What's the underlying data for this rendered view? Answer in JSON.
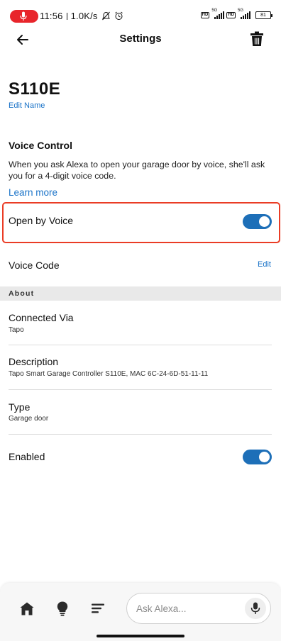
{
  "status_bar": {
    "time": "11:56",
    "network_speed": "1.0K/s",
    "hd_badge_1": "HD",
    "hd_badge_2": "HD",
    "signal_1_label": "5G",
    "signal_2_label": "5G",
    "battery": "81",
    "recording_color": "#e8252b"
  },
  "header": {
    "title": "Settings",
    "back_icon": "arrow-left-icon",
    "delete_icon": "trash-icon"
  },
  "device": {
    "name": "S110E",
    "edit_name_link": "Edit Name"
  },
  "voice_control": {
    "heading": "Voice Control",
    "description": "When you ask Alexa to open your garage door by voice, she'll ask you for a 4-digit voice code.",
    "learn_more": "Learn more",
    "open_by_voice_label": "Open by Voice",
    "open_by_voice_enabled": true,
    "voice_code_label": "Voice Code",
    "voice_code_edit": "Edit"
  },
  "about": {
    "section_label": "About",
    "items": [
      {
        "title": "Connected Via",
        "value": "Tapo"
      },
      {
        "title": "Description",
        "value": "Tapo Smart Garage Controller S110E, MAC 6C-24-6D-51-11-11"
      },
      {
        "title": "Type",
        "value": "Garage door"
      }
    ],
    "enabled_label": "Enabled",
    "enabled_state": true
  },
  "bottom_nav": {
    "icons": [
      "home-icon",
      "devices-bulb-icon",
      "more-menu-icon"
    ],
    "ask_placeholder": "Ask Alexa...",
    "mic_icon": "microphone-icon"
  },
  "colors": {
    "accent_blue": "#1a73c8",
    "toggle_on": "#1d6fb8",
    "highlight_red": "#ea3c25",
    "section_band": "#e9e9e9"
  }
}
